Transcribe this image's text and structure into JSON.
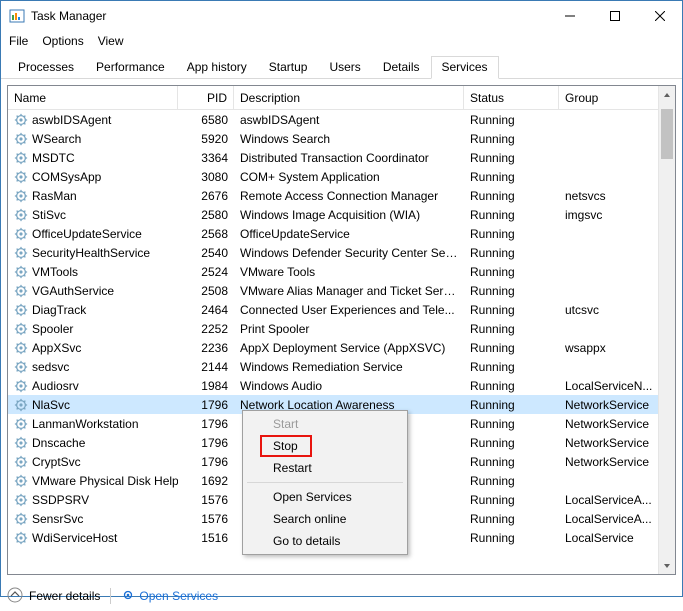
{
  "window": {
    "title": "Task Manager"
  },
  "menubar": [
    "File",
    "Options",
    "View"
  ],
  "tabs": [
    "Processes",
    "Performance",
    "App history",
    "Startup",
    "Users",
    "Details",
    "Services"
  ],
  "activeTab": 6,
  "columns": {
    "name": "Name",
    "pid": "PID",
    "desc": "Description",
    "status": "Status",
    "group": "Group"
  },
  "selectedIndex": 14,
  "rows": [
    {
      "name": "aswbIDSAgent",
      "pid": "6580",
      "desc": "aswbIDSAgent",
      "status": "Running",
      "group": ""
    },
    {
      "name": "WSearch",
      "pid": "5920",
      "desc": "Windows Search",
      "status": "Running",
      "group": ""
    },
    {
      "name": "MSDTC",
      "pid": "3364",
      "desc": "Distributed Transaction Coordinator",
      "status": "Running",
      "group": ""
    },
    {
      "name": "COMSysApp",
      "pid": "3080",
      "desc": "COM+ System Application",
      "status": "Running",
      "group": ""
    },
    {
      "name": "RasMan",
      "pid": "2676",
      "desc": "Remote Access Connection Manager",
      "status": "Running",
      "group": "netsvcs"
    },
    {
      "name": "StiSvc",
      "pid": "2580",
      "desc": "Windows Image Acquisition (WIA)",
      "status": "Running",
      "group": "imgsvc"
    },
    {
      "name": "OfficeUpdateService",
      "pid": "2568",
      "desc": "OfficeUpdateService",
      "status": "Running",
      "group": ""
    },
    {
      "name": "SecurityHealthService",
      "pid": "2540",
      "desc": "Windows Defender Security Center Ser...",
      "status": "Running",
      "group": ""
    },
    {
      "name": "VMTools",
      "pid": "2524",
      "desc": "VMware Tools",
      "status": "Running",
      "group": ""
    },
    {
      "name": "VGAuthService",
      "pid": "2508",
      "desc": "VMware Alias Manager and Ticket Serv...",
      "status": "Running",
      "group": ""
    },
    {
      "name": "DiagTrack",
      "pid": "2464",
      "desc": "Connected User Experiences and Tele...",
      "status": "Running",
      "group": "utcsvc"
    },
    {
      "name": "Spooler",
      "pid": "2252",
      "desc": "Print Spooler",
      "status": "Running",
      "group": ""
    },
    {
      "name": "AppXSvc",
      "pid": "2236",
      "desc": "AppX Deployment Service (AppXSVC)",
      "status": "Running",
      "group": "wsappx"
    },
    {
      "name": "sedsvc",
      "pid": "2144",
      "desc": "Windows Remediation Service",
      "status": "Running",
      "group": ""
    },
    {
      "name": "Audiosrv",
      "pid": "1984",
      "desc": "Windows Audio",
      "status": "Running",
      "group": "LocalServiceN..."
    },
    {
      "name": "NlaSvc",
      "pid": "1796",
      "desc": "Network Location Awareness",
      "status": "Running",
      "group": "NetworkService"
    },
    {
      "name": "LanmanWorkstation",
      "pid": "1796",
      "desc": "",
      "status": "Running",
      "group": "NetworkService"
    },
    {
      "name": "Dnscache",
      "pid": "1796",
      "desc": "",
      "status": "Running",
      "group": "NetworkService"
    },
    {
      "name": "CryptSvc",
      "pid": "1796",
      "desc": "",
      "status": "Running",
      "group": "NetworkService"
    },
    {
      "name": "VMware Physical Disk Help...",
      "pid": "1692",
      "desc": "",
      "status": "Running",
      "group": ""
    },
    {
      "name": "SSDPSRV",
      "pid": "1576",
      "desc": "",
      "status": "Running",
      "group": "LocalServiceA..."
    },
    {
      "name": "SensrSvc",
      "pid": "1576",
      "desc": "",
      "status": "Running",
      "group": "LocalServiceA..."
    },
    {
      "name": "WdiServiceHost",
      "pid": "1516",
      "desc": "",
      "status": "Running",
      "group": "LocalService"
    }
  ],
  "contextMenu": {
    "start": "Start",
    "stop": "Stop",
    "restart": "Restart",
    "openServices": "Open Services",
    "searchOnline": "Search online",
    "goToDetails": "Go to details"
  },
  "footer": {
    "fewer": "Fewer details",
    "open": "Open Services"
  }
}
